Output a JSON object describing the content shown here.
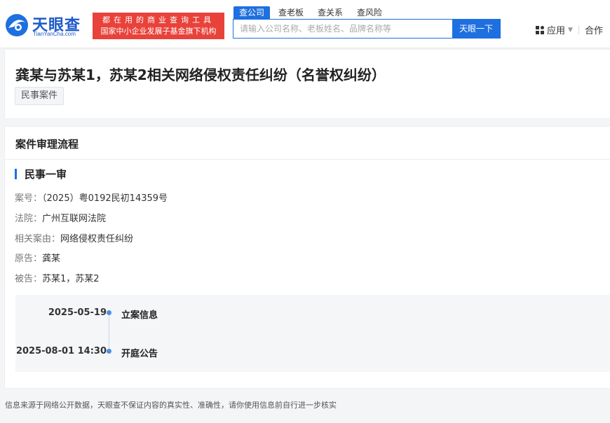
{
  "header": {
    "logo_text": "天眼查",
    "logo_sub": "TianYanCha.com",
    "slogan_line1": "都在用的商业查询工具",
    "slogan_line2": "国家中小企业发展子基金旗下机构",
    "search_tabs": [
      "查公司",
      "查老板",
      "查关系",
      "查风险"
    ],
    "search_placeholder": "请输入公司名称、老板姓名、品牌名称等",
    "search_button": "天眼一下",
    "apps_label": "应用",
    "cooperate_label": "合作"
  },
  "case": {
    "title": "龚某与苏某1，苏某2相关网络侵权责任纠纷（名誉权纠纷）",
    "tag": "民事案件"
  },
  "process": {
    "section_title": "案件审理流程",
    "stage_title": "民事一审",
    "fields": [
      {
        "label": "案号：",
        "value": "（2025）粤0192民初14359号"
      },
      {
        "label": "法院：",
        "value": "广州互联网法院"
      },
      {
        "label": "相关案由：",
        "value": "网络侵权责任纠纷"
      },
      {
        "label": "原告：",
        "value": "龚某"
      },
      {
        "label": "被告：",
        "value": "苏某1，苏某2"
      }
    ],
    "timeline": [
      {
        "date": "2025-05-19",
        "label": "立案信息"
      },
      {
        "date": "2025-08-01 14:30",
        "label": "开庭公告"
      }
    ]
  },
  "footer_text": "信息来源于网络公开数据，天眼查不保证内容的真实性、准确性，请你使用信息前自行进一步核实",
  "colors": {
    "brand_blue": "#1e6fe0",
    "slogan_red": "#e8423a"
  }
}
